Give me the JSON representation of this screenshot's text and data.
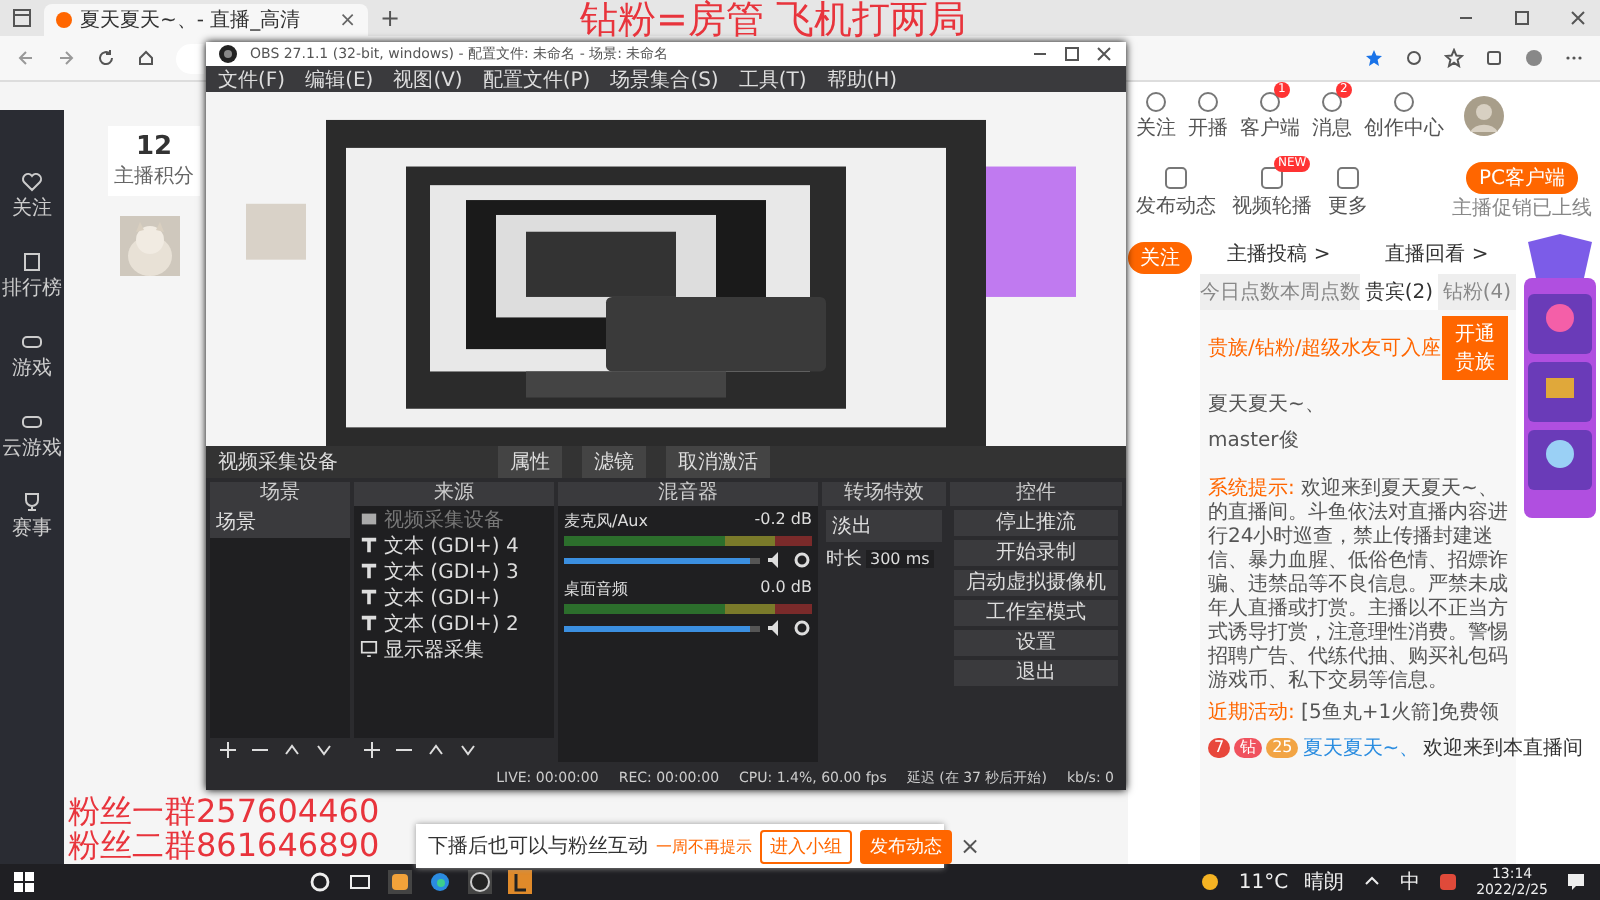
{
  "browser": {
    "tab_title": "夏天夏天~、- 直播_高清",
    "new_tab": "+",
    "tab_close": "×"
  },
  "overlay_text": "钻粉=房管 飞机打两局",
  "fan_groups": [
    "粉丝一群257604460",
    "粉丝二群861646890"
  ],
  "sidebar": {
    "items": [
      {
        "label": "关注",
        "kind": "heart"
      },
      {
        "label": "排行榜",
        "kind": "book"
      },
      {
        "label": "游戏",
        "kind": "pad"
      },
      {
        "label": "云游戏",
        "kind": "pad"
      },
      {
        "label": "赛事",
        "kind": "cup"
      }
    ]
  },
  "score": {
    "value": "12",
    "label": "主播积分"
  },
  "top_nav": [
    {
      "label": "关注"
    },
    {
      "label": "开播"
    },
    {
      "label": "客户端",
      "badge": "1"
    },
    {
      "label": "消息",
      "badge": "2"
    },
    {
      "label": "创作中心"
    }
  ],
  "actions": [
    {
      "label": "发布动态"
    },
    {
      "label": "视频轮播",
      "badge": "NEW"
    },
    {
      "label": "更多"
    }
  ],
  "pc_client": {
    "button": "PC客户端",
    "note": "主播促销已上线"
  },
  "panel": {
    "follow": "关注",
    "links": [
      "主播投稿 >",
      "直播回看 >"
    ],
    "tabs": [
      {
        "label": "今日点数",
        "selected": false
      },
      {
        "label": "本周点数",
        "selected": false
      },
      {
        "label": "贵宾(2)",
        "selected": true
      },
      {
        "label": "钻粉(4)",
        "selected": false
      }
    ],
    "seat_note": "贵族/钻粉/超级水友可入座",
    "open_button": "开通贵族",
    "members": [
      "夏天夏天~、",
      "master俊"
    ]
  },
  "chat": [
    {
      "kind": "notice",
      "label": "系统提示:",
      "text": "欢迎来到夏天夏天~、的直播间。斗鱼依法对直播内容进行24小时巡查，禁止传播封建迷信、暴力血腥、低俗色情、招嫖诈骗、违禁品等不良信息。严禁未成年人直播或打赏。主播以不正当方式诱导打赏，注意理性消费。警惕招聘广告、代练代抽、购买礼包码游戏币、私下交易等信息。"
    },
    {
      "kind": "notice",
      "label": "近期活动:",
      "text": "[5鱼丸+1火箭]免费领"
    },
    {
      "kind": "message",
      "badges": [
        {
          "text": "7",
          "color": "#e8473b"
        },
        {
          "text": "钻",
          "color": "#f0525e"
        },
        {
          "text": "25",
          "color": "#f2a444"
        }
      ],
      "user": "夏天夏天~、",
      "text": "欢迎来到本直播间"
    }
  ],
  "obs": {
    "title": "OBS 27.1.1 (32-bit, windows) - 配置文件: 未命名 - 场景: 未命名",
    "menu": [
      "文件(F)",
      "编辑(E)",
      "视图(V)",
      "配置文件(P)",
      "场景集合(S)",
      "工具(T)",
      "帮助(H)"
    ],
    "source_bar": {
      "source": "视频采集设备",
      "buttons": [
        "属性",
        "滤镜",
        "取消激活"
      ]
    },
    "scenes": {
      "title": "场景",
      "items": [
        "场景"
      ]
    },
    "sources": {
      "title": "来源",
      "items": [
        {
          "kind": "camera",
          "label": "视频采集设备",
          "disabled": true
        },
        {
          "kind": "text",
          "label": "文本 (GDI+) 4",
          "disabled": false
        },
        {
          "kind": "text",
          "label": "文本 (GDI+) 3",
          "disabled": false
        },
        {
          "kind": "text",
          "label": "文本 (GDI+)",
          "disabled": false
        },
        {
          "kind": "text",
          "label": "文本 (GDI+) 2",
          "disabled": false
        },
        {
          "kind": "display",
          "label": "显示器采集",
          "disabled": false
        }
      ]
    },
    "mixer": {
      "title": "混音器",
      "channels": [
        {
          "name": "麦克风/Aux",
          "reading": "-0.2 dB",
          "level": 0.95
        },
        {
          "name": "桌面音频",
          "reading": "0.0 dB",
          "level": 0.95
        }
      ]
    },
    "transitions": {
      "title": "转场特效",
      "value": "淡出",
      "duration_label": "时长",
      "duration": "300 ms"
    },
    "controls": {
      "title": "控件",
      "buttons": [
        "停止推流",
        "开始录制",
        "启动虚拟摄像机",
        "工作室模式",
        "设置",
        "退出"
      ]
    },
    "status": [
      "LIVE: 00:00:00",
      "REC: 00:00:00",
      "CPU: 1.4%, 60.00 fps",
      "延迟 (在 37 秒后开始)",
      "kb/s: 0"
    ]
  },
  "notification": {
    "text": "下播后也可以与粉丝互动",
    "dismiss": "一周不再提示",
    "buttons": [
      "进入小组",
      "发布动态"
    ],
    "close": "×"
  },
  "taskbar": {
    "temperature": "11°C",
    "weather": "晴朗",
    "ime": "中",
    "time": "13:14",
    "date": "2022/2/25"
  }
}
